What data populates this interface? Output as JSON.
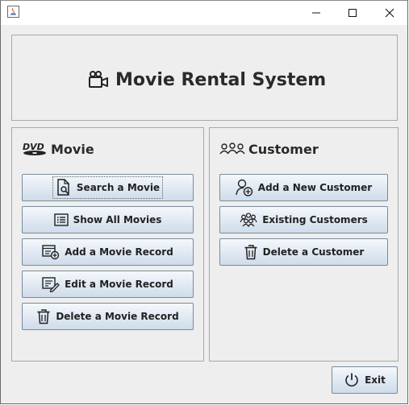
{
  "header": {
    "title": "Movie Rental System"
  },
  "movie_section": {
    "title": "Movie",
    "buttons": [
      {
        "label": "Search a Movie",
        "icon": "search-document-icon"
      },
      {
        "label": "Show All Movies",
        "icon": "list-icon"
      },
      {
        "label": "Add a Movie Record",
        "icon": "add-record-icon"
      },
      {
        "label": "Edit a Movie Record",
        "icon": "edit-record-icon"
      },
      {
        "label": "Delete a Movie Record",
        "icon": "trash-icon"
      }
    ]
  },
  "customer_section": {
    "title": "Customer",
    "buttons": [
      {
        "label": "Add a New Customer",
        "icon": "add-user-icon"
      },
      {
        "label": "Existing Customers",
        "icon": "users-icon"
      },
      {
        "label": "Delete a Customer",
        "icon": "trash-icon"
      }
    ]
  },
  "footer": {
    "exit_label": "Exit"
  }
}
